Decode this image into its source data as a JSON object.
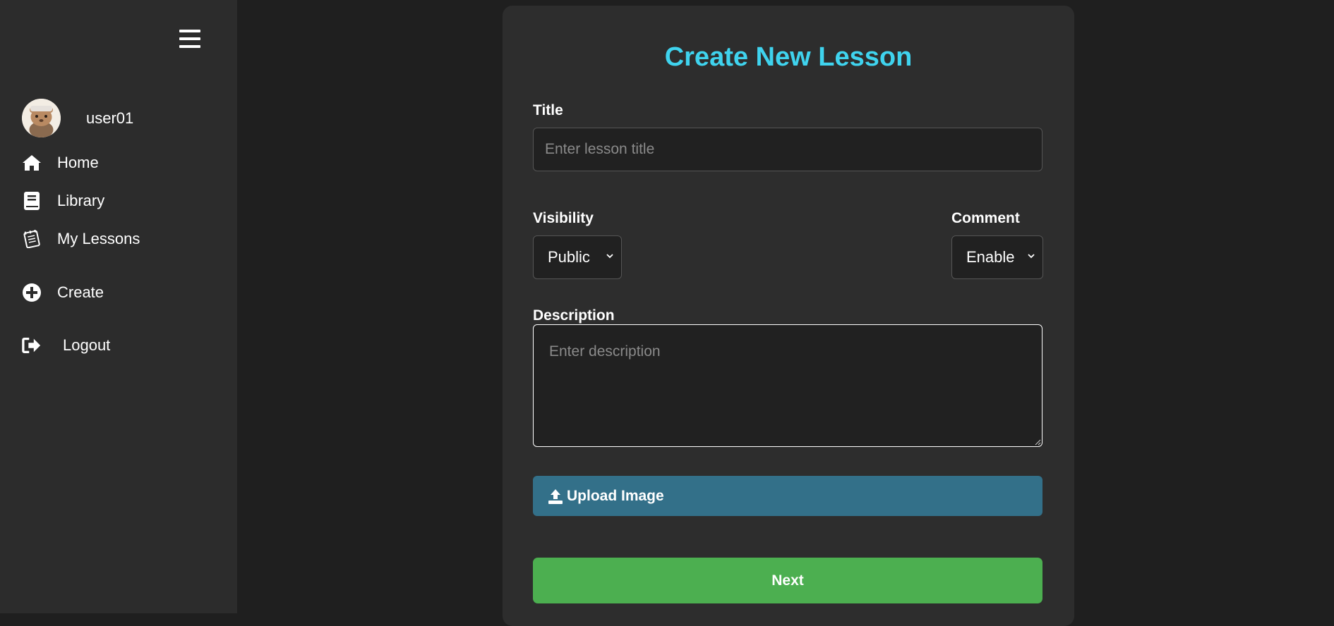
{
  "sidebar": {
    "user": {
      "name": "user01"
    },
    "nav": {
      "home": "Home",
      "library": "Library",
      "my_lessons": "My Lessons",
      "create": "Create",
      "logout": "Logout"
    }
  },
  "form": {
    "title": "Create New Lesson",
    "title_label": "Title",
    "title_placeholder": "Enter lesson title",
    "title_value": "",
    "visibility_label": "Visibility",
    "visibility_value": "Public",
    "comment_label": "Comment",
    "comment_value": "Enable",
    "description_label": "Description",
    "description_placeholder": "Enter description",
    "upload_label": "Upload Image",
    "next_label": "Next"
  },
  "colors": {
    "accent_title": "#3fd3ee",
    "upload_button": "#337089",
    "next_button": "#4caf50"
  }
}
